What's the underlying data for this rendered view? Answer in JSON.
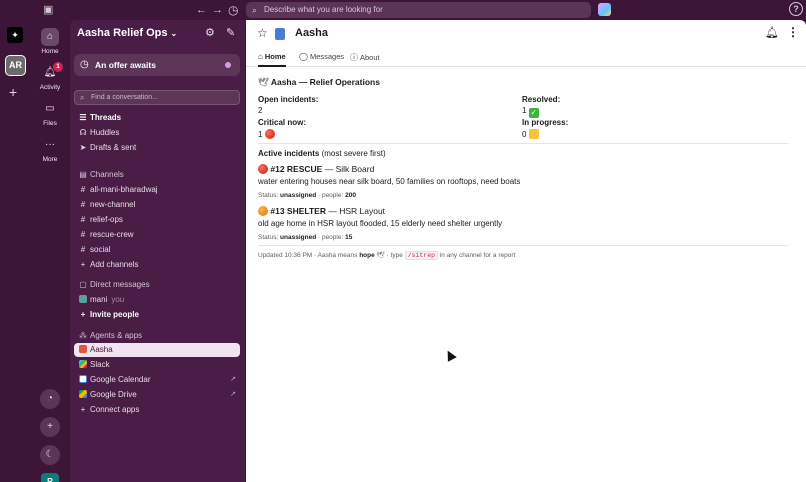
{
  "topbar": {
    "search_placeholder": "Describe what you are looking for",
    "help_label": "?"
  },
  "rail": {
    "workspace_initials": "AR"
  },
  "nav": {
    "home": "Home",
    "activity": "Activity",
    "activity_badge": "1",
    "files": "Files",
    "more": "More",
    "user_initial": "R"
  },
  "sidebar": {
    "workspace_name": "Aasha Relief Ops",
    "offer": "An offer awaits",
    "find_placeholder": "Find a conversation...",
    "top_items": [
      "Threads",
      "Huddles",
      "Drafts & sent"
    ],
    "channels_header": "Channels",
    "channels": [
      "all-mani-bharadwaj",
      "new-channel",
      "relief-ops",
      "rescue-crew",
      "social"
    ],
    "add_channels": "Add channels",
    "dm_header": "Direct messages",
    "dm_user": "mani",
    "dm_user_suffix": "you",
    "invite": "Invite people",
    "apps_header": "Agents & apps",
    "apps": [
      "Aasha",
      "Slack",
      "Google Calendar",
      "Google Drive"
    ],
    "connect_apps": "Connect apps"
  },
  "main": {
    "title": "Aasha",
    "tabs": [
      "Home",
      "Messages",
      "About"
    ],
    "heading": "Aasha — Relief Operations",
    "stats": {
      "open_label": "Open incidents:",
      "open_value": "2",
      "resolved_label": "Resolved:",
      "resolved_value": "1",
      "critical_label": "Critical now:",
      "critical_value": "1",
      "progress_label": "In progress:",
      "progress_value": "0"
    },
    "active_label": "Active incidents",
    "active_sub": "(most severe first)",
    "incidents": [
      {
        "id": "#12 RESCUE",
        "location": "— Silk Board",
        "desc": "water entering houses near silk board, 50 families on rooftops, need boats",
        "status_prefix": "Status:",
        "status": "unassigned",
        "people_prefix": "· people:",
        "people": "200",
        "color": "#d11a0a"
      },
      {
        "id": "#13 SHELTER",
        "location": "— HSR Layout",
        "desc": "old age home in HSR layout flooded, 15 elderly need shelter urgently",
        "status_prefix": "Status:",
        "status": "unassigned",
        "people_prefix": "· people:",
        "people": "15",
        "color": "#e0740a"
      }
    ],
    "footer": {
      "prefix": "Updated 10:36 PM · Aasha means",
      "hope": "hope",
      "type": "· type",
      "cmd": "/sitrep",
      "suffix": "in any channel for a report"
    }
  },
  "colors": {
    "aubergine": "#3c1539",
    "sidebar": "#4a1d47",
    "selected": "#f2e3f0"
  }
}
